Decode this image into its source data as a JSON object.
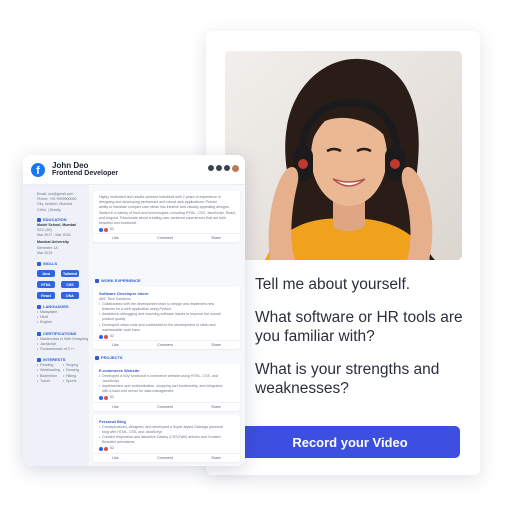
{
  "resume": {
    "name": "John Deo",
    "role": "Frontend Developer",
    "contact": [
      "Email: xxx@gmail.com",
      "Phone: +91 9999900000",
      "City: Andheri, Mumbai",
      "CtHsl. | Dravity"
    ],
    "education": {
      "title": "EDUCATION",
      "entries": [
        {
          "school": "Model School, Mumbai",
          "lines": [
            "SSC (80)",
            "Mar 2017 - Mar 2018"
          ]
        },
        {
          "school": "Mumbai University",
          "lines": [
            "Semester 1A",
            "Mar 2019"
          ]
        }
      ]
    },
    "skills": {
      "title": "SKILLS",
      "items": [
        "Java",
        "Tailwind",
        "HTML",
        "CSS",
        "React",
        "DNA"
      ]
    },
    "languages": {
      "title": "LANGUAGES",
      "items": [
        "Malayalam",
        "Hindi",
        "English"
      ]
    },
    "certifications": {
      "title": "CERTIFICATIONS",
      "items": [
        "Masterclass in Web Designing",
        "Javascript",
        "Fundamentals of C++"
      ]
    },
    "interests": {
      "title": "INTERESTS",
      "items": [
        "Reading",
        "Singing",
        "Webfeasting",
        "Dancing",
        "Badminton",
        "Hiking",
        "Travel",
        "Sports"
      ]
    },
    "about_post": {
      "text": [
        "Highly motivated and results-oriented individual with 2 years of experience in",
        "designing and developing performant and robust web applications. Proven",
        "ability to translate complex user ideas into intuitive and visually appealing designs.",
        "Skilled in a variety of front-end technologies, including HTML, CSS, JavaScript, React,",
        "and Angular. Passionate about creating user-centered experiences that are both",
        "beautiful and functional."
      ],
      "reactions": "62"
    },
    "work": {
      "title": "WORK EXPERIENCE",
      "post_title": "Software Developer Intern",
      "company": "ABC Tech Solutions",
      "bullets": [
        "Collaborated with the development team to design and implement new",
        "features for a web application using Python",
        "Assisted in debugging and resolving software issues to improve the overall",
        "product quality",
        "Developed clean code and contributed to the development of clean and",
        "maintainable code base"
      ],
      "reactions": "62"
    },
    "projects": {
      "title": "PROJECTS",
      "items": [
        {
          "post_title": "E-commerce Website",
          "bullets": [
            "Developed a fully functional e-commerce website using HTML, CSS, and",
            "JavaScript",
            "Implemented user authentication, shopping cart functionality, and integrated",
            "with a back-end server for data management"
          ],
          "reactions": "62"
        },
        {
          "post_title": "Personal Blog",
          "bullets": [
            "Conceptualized, designed, and developed a Super-styled Gatsbyjs personal",
            "blog with HTML, CSS, and JavaScript",
            "Created responsive and attractive Gatsby (CSS/Twirl) articles and Created",
            "Beautiful animations"
          ],
          "reactions": "62"
        }
      ]
    },
    "actions": {
      "like": "Like",
      "comment": "Comment",
      "share": "Share"
    }
  },
  "interview": {
    "questions": [
      "Tell me about yourself.",
      "What software or HR tools are you familiar with?",
      "What is your strengths and weaknesses?"
    ],
    "record_label": "Record your Video"
  },
  "colors": {
    "accent": "#3d4fe0",
    "resume_blue": "#2f5bd3",
    "facebook": "#1877f2"
  }
}
